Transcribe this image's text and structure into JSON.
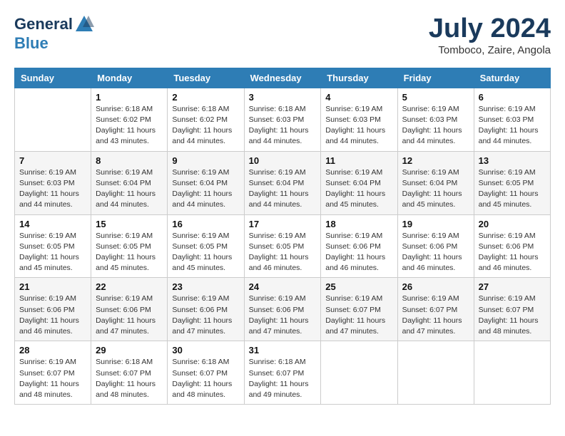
{
  "header": {
    "logo_general": "General",
    "logo_blue": "Blue",
    "month_year": "July 2024",
    "location": "Tomboco, Zaire, Angola"
  },
  "calendar": {
    "days_of_week": [
      "Sunday",
      "Monday",
      "Tuesday",
      "Wednesday",
      "Thursday",
      "Friday",
      "Saturday"
    ],
    "weeks": [
      [
        {
          "day": "",
          "info": ""
        },
        {
          "day": "1",
          "info": "Sunrise: 6:18 AM\nSunset: 6:02 PM\nDaylight: 11 hours\nand 43 minutes."
        },
        {
          "day": "2",
          "info": "Sunrise: 6:18 AM\nSunset: 6:02 PM\nDaylight: 11 hours\nand 44 minutes."
        },
        {
          "day": "3",
          "info": "Sunrise: 6:18 AM\nSunset: 6:03 PM\nDaylight: 11 hours\nand 44 minutes."
        },
        {
          "day": "4",
          "info": "Sunrise: 6:19 AM\nSunset: 6:03 PM\nDaylight: 11 hours\nand 44 minutes."
        },
        {
          "day": "5",
          "info": "Sunrise: 6:19 AM\nSunset: 6:03 PM\nDaylight: 11 hours\nand 44 minutes."
        },
        {
          "day": "6",
          "info": "Sunrise: 6:19 AM\nSunset: 6:03 PM\nDaylight: 11 hours\nand 44 minutes."
        }
      ],
      [
        {
          "day": "7",
          "info": "Sunrise: 6:19 AM\nSunset: 6:03 PM\nDaylight: 11 hours\nand 44 minutes."
        },
        {
          "day": "8",
          "info": "Sunrise: 6:19 AM\nSunset: 6:04 PM\nDaylight: 11 hours\nand 44 minutes."
        },
        {
          "day": "9",
          "info": "Sunrise: 6:19 AM\nSunset: 6:04 PM\nDaylight: 11 hours\nand 44 minutes."
        },
        {
          "day": "10",
          "info": "Sunrise: 6:19 AM\nSunset: 6:04 PM\nDaylight: 11 hours\nand 44 minutes."
        },
        {
          "day": "11",
          "info": "Sunrise: 6:19 AM\nSunset: 6:04 PM\nDaylight: 11 hours\nand 45 minutes."
        },
        {
          "day": "12",
          "info": "Sunrise: 6:19 AM\nSunset: 6:04 PM\nDaylight: 11 hours\nand 45 minutes."
        },
        {
          "day": "13",
          "info": "Sunrise: 6:19 AM\nSunset: 6:05 PM\nDaylight: 11 hours\nand 45 minutes."
        }
      ],
      [
        {
          "day": "14",
          "info": "Sunrise: 6:19 AM\nSunset: 6:05 PM\nDaylight: 11 hours\nand 45 minutes."
        },
        {
          "day": "15",
          "info": "Sunrise: 6:19 AM\nSunset: 6:05 PM\nDaylight: 11 hours\nand 45 minutes."
        },
        {
          "day": "16",
          "info": "Sunrise: 6:19 AM\nSunset: 6:05 PM\nDaylight: 11 hours\nand 45 minutes."
        },
        {
          "day": "17",
          "info": "Sunrise: 6:19 AM\nSunset: 6:05 PM\nDaylight: 11 hours\nand 46 minutes."
        },
        {
          "day": "18",
          "info": "Sunrise: 6:19 AM\nSunset: 6:06 PM\nDaylight: 11 hours\nand 46 minutes."
        },
        {
          "day": "19",
          "info": "Sunrise: 6:19 AM\nSunset: 6:06 PM\nDaylight: 11 hours\nand 46 minutes."
        },
        {
          "day": "20",
          "info": "Sunrise: 6:19 AM\nSunset: 6:06 PM\nDaylight: 11 hours\nand 46 minutes."
        }
      ],
      [
        {
          "day": "21",
          "info": "Sunrise: 6:19 AM\nSunset: 6:06 PM\nDaylight: 11 hours\nand 46 minutes."
        },
        {
          "day": "22",
          "info": "Sunrise: 6:19 AM\nSunset: 6:06 PM\nDaylight: 11 hours\nand 47 minutes."
        },
        {
          "day": "23",
          "info": "Sunrise: 6:19 AM\nSunset: 6:06 PM\nDaylight: 11 hours\nand 47 minutes."
        },
        {
          "day": "24",
          "info": "Sunrise: 6:19 AM\nSunset: 6:06 PM\nDaylight: 11 hours\nand 47 minutes."
        },
        {
          "day": "25",
          "info": "Sunrise: 6:19 AM\nSunset: 6:07 PM\nDaylight: 11 hours\nand 47 minutes."
        },
        {
          "day": "26",
          "info": "Sunrise: 6:19 AM\nSunset: 6:07 PM\nDaylight: 11 hours\nand 47 minutes."
        },
        {
          "day": "27",
          "info": "Sunrise: 6:19 AM\nSunset: 6:07 PM\nDaylight: 11 hours\nand 48 minutes."
        }
      ],
      [
        {
          "day": "28",
          "info": "Sunrise: 6:19 AM\nSunset: 6:07 PM\nDaylight: 11 hours\nand 48 minutes."
        },
        {
          "day": "29",
          "info": "Sunrise: 6:18 AM\nSunset: 6:07 PM\nDaylight: 11 hours\nand 48 minutes."
        },
        {
          "day": "30",
          "info": "Sunrise: 6:18 AM\nSunset: 6:07 PM\nDaylight: 11 hours\nand 48 minutes."
        },
        {
          "day": "31",
          "info": "Sunrise: 6:18 AM\nSunset: 6:07 PM\nDaylight: 11 hours\nand 49 minutes."
        },
        {
          "day": "",
          "info": ""
        },
        {
          "day": "",
          "info": ""
        },
        {
          "day": "",
          "info": ""
        }
      ]
    ]
  }
}
